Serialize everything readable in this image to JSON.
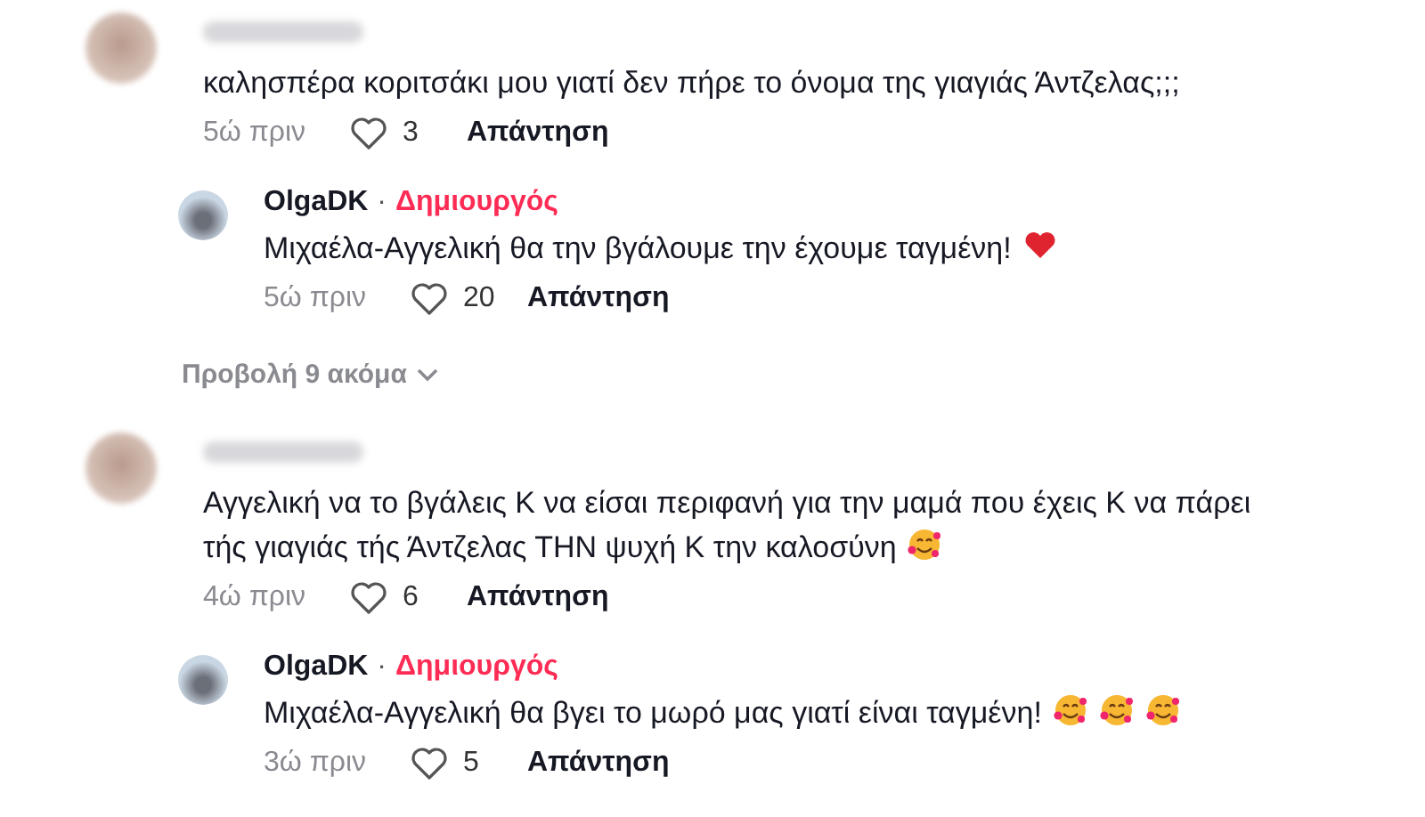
{
  "threads": [
    {
      "comment": {
        "name_hidden": true,
        "text": "καλησπέρα κοριτσάκι μου γιατί δεν πήρε το όνομα της γιαγιάς Άντζελας;;;",
        "time": "5ώ πριν",
        "likes": "3",
        "reply": "Απάντηση"
      },
      "replies": [
        {
          "author": "OlgaDK",
          "separator": "·",
          "badge": "Δημιουργός",
          "text": "Μιχαέλα-Αγγελική θα την βγάλουμε την έχουμε ταγμένη!",
          "emojis": [
            {
              "kind": "heart"
            }
          ],
          "time": "5ώ πριν",
          "likes": "20",
          "reply": "Απάντηση"
        }
      ],
      "more": "Προβολή 9 ακόμα"
    },
    {
      "comment": {
        "name_hidden": true,
        "text": "Αγγελική να το βγάλεις Κ να είσαι περιφανή για την μαμά που έχεις Κ να πάρει τής γιαγιάς τής Άντζελας ΤΗΝ ψυχή Κ την καλοσύνη",
        "emojis": [
          {
            "kind": "hug"
          }
        ],
        "time": "4ώ πριν",
        "likes": "6",
        "reply": "Απάντηση"
      },
      "replies": [
        {
          "author": "OlgaDK",
          "separator": "·",
          "badge": "Δημιουργός",
          "text": "Μιχαέλα-Αγγελική θα βγει το μωρό μας γιατί είναι ταγμένη!",
          "emojis": [
            {
              "kind": "hug"
            },
            {
              "kind": "hug"
            },
            {
              "kind": "hug"
            }
          ],
          "time": "3ώ πριν",
          "likes": "5",
          "reply": "Απάντηση"
        }
      ]
    }
  ]
}
